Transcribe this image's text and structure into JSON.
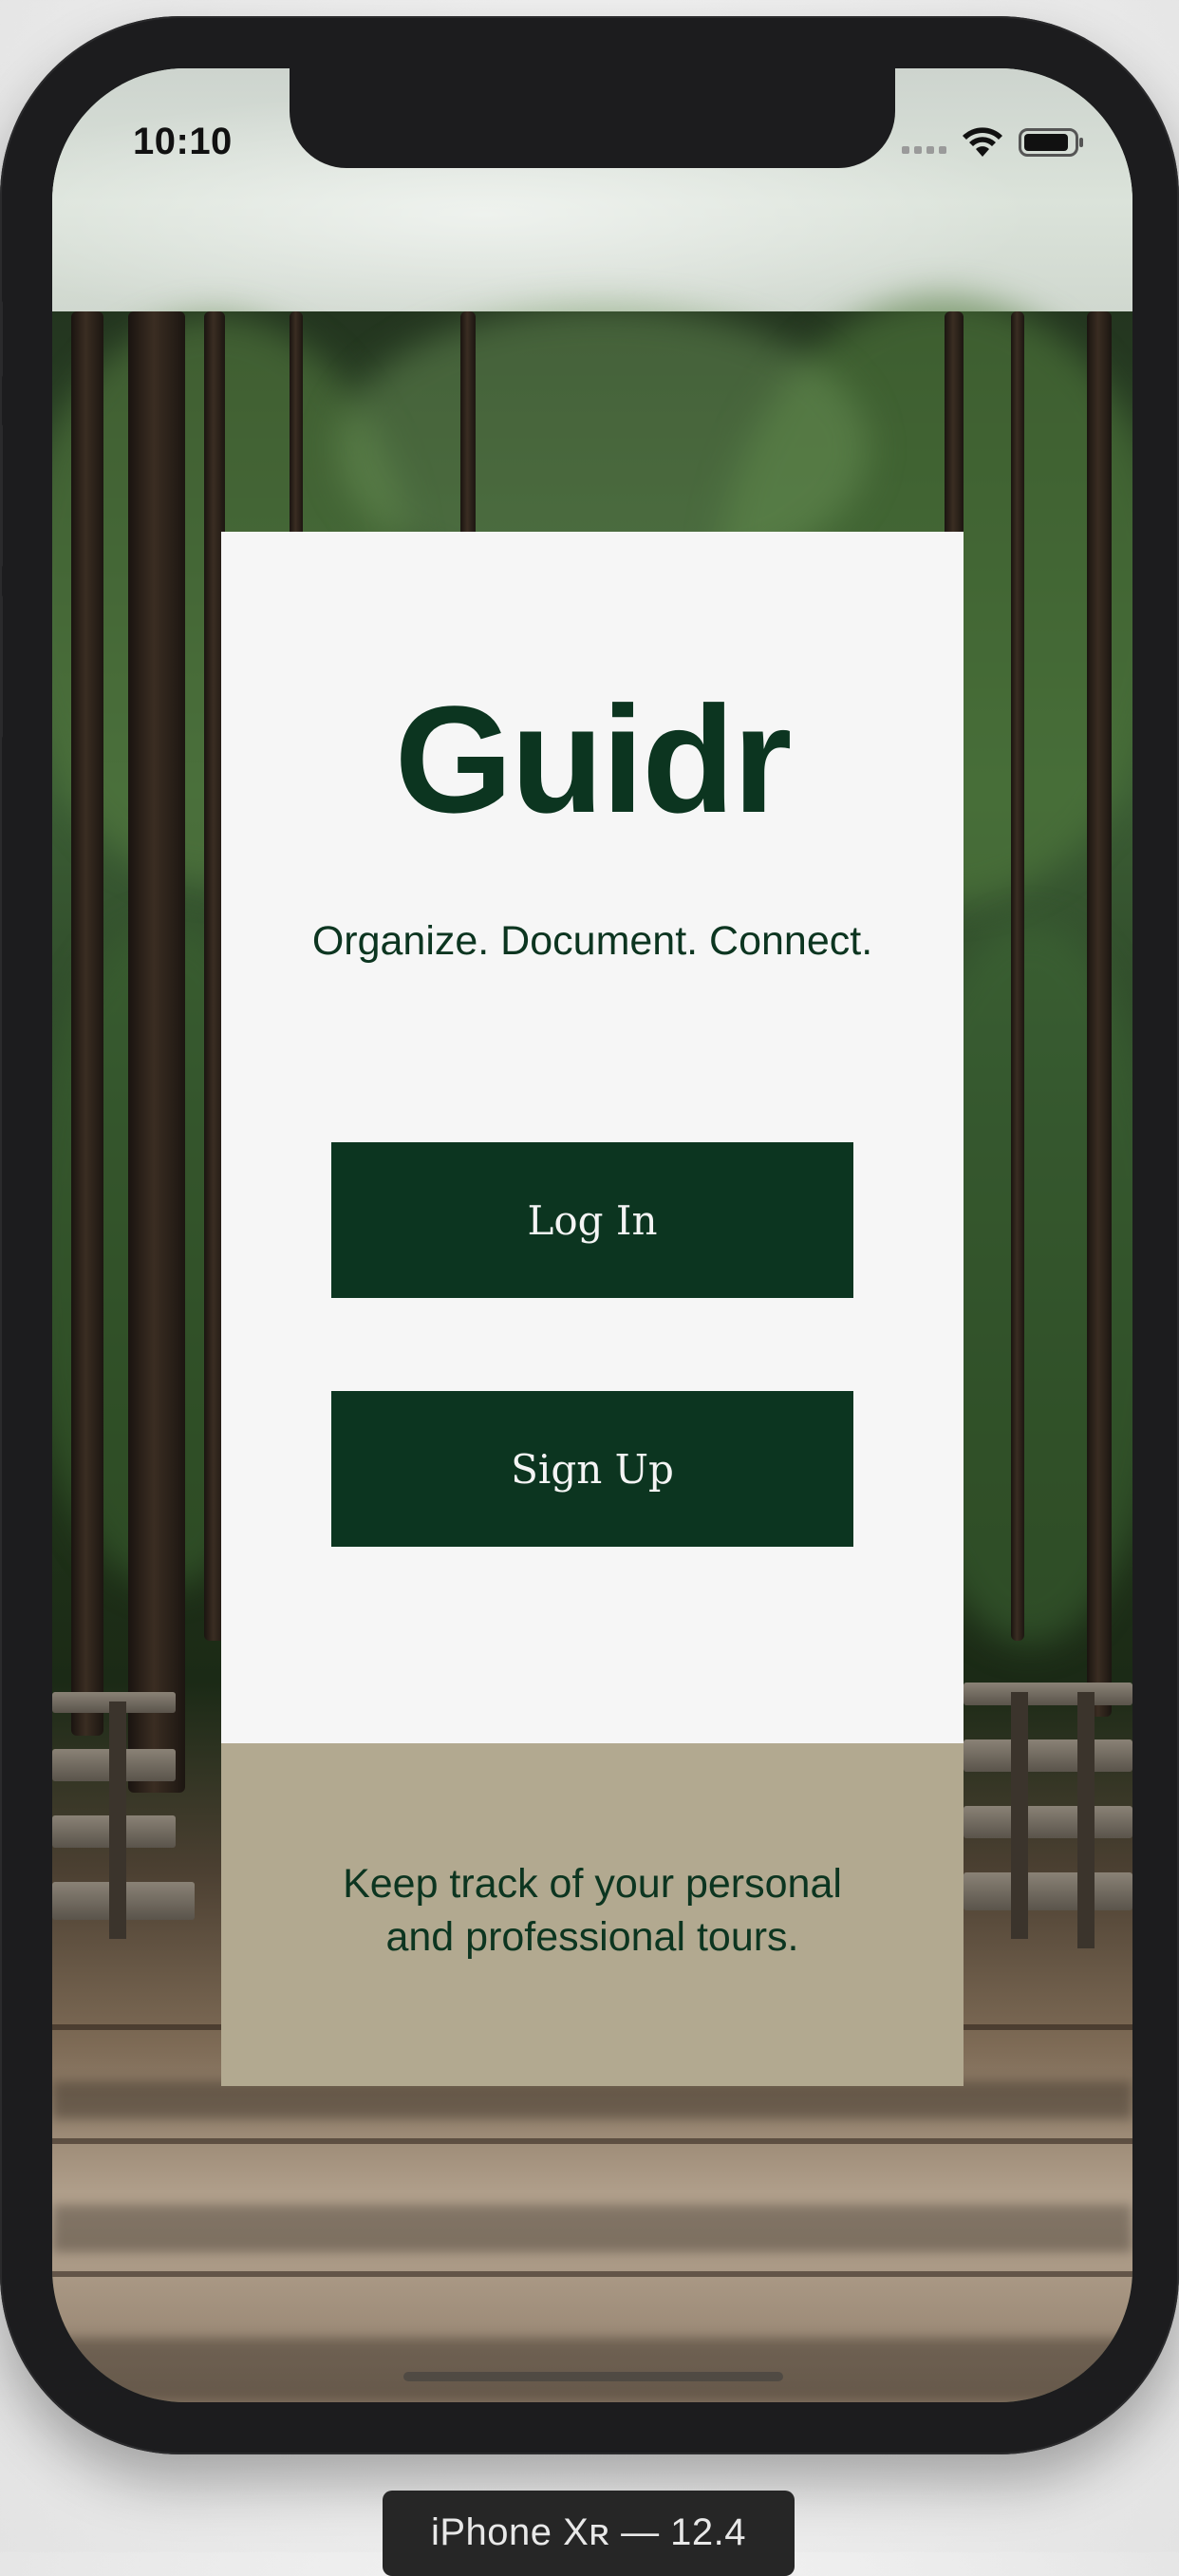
{
  "status_bar": {
    "time": "10:10",
    "wifi_icon": "wifi-icon",
    "battery_icon": "battery-icon",
    "signal_icon": "cellular-signal-icon"
  },
  "card": {
    "title": "Guidr",
    "tagline": "Organize. Document. Connect.",
    "login_label": "Log In",
    "signup_label": "Sign Up",
    "footer_text": "Keep track of your personal and professional tours."
  },
  "simulator": {
    "device_label": "iPhone Xʀ — 12.4"
  },
  "colors": {
    "brand_green": "#0c3520",
    "card_bg": "#f6f6f6",
    "footer_bg": "#b2a990",
    "button_text": "#f4f4f4"
  }
}
